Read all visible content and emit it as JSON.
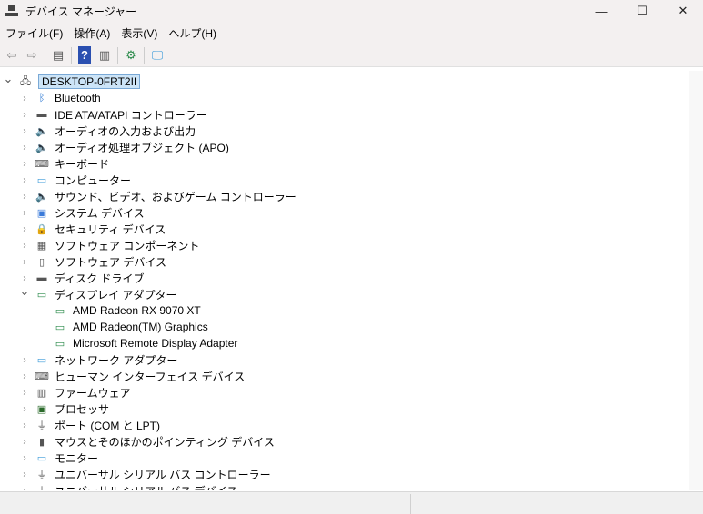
{
  "window": {
    "title": "デバイス マネージャー",
    "minimize": "—",
    "maximize": "☐",
    "close": "✕"
  },
  "menu": [
    "ファイル(F)",
    "操作(A)",
    "表示(V)",
    "ヘルプ(H)"
  ],
  "toolbar": [
    {
      "name": "back-icon",
      "glyph": "⇦"
    },
    {
      "name": "forward-icon",
      "glyph": "⇨"
    },
    {
      "name": "sep"
    },
    {
      "name": "show-hide-tree-icon",
      "glyph": "▤"
    },
    {
      "name": "sep"
    },
    {
      "name": "help-icon",
      "glyph": "?"
    },
    {
      "name": "properties-icon",
      "glyph": "▥"
    },
    {
      "name": "sep"
    },
    {
      "name": "update-driver-icon",
      "glyph": "⚙"
    },
    {
      "name": "sep"
    },
    {
      "name": "scan-hardware-icon",
      "glyph": "🖵"
    }
  ],
  "tree": [
    {
      "label": "DESKTOP-0FRT2II",
      "level": 0,
      "expanded": true,
      "icon": "computer-network-icon"
    },
    {
      "label": "Bluetooth",
      "level": 1,
      "icon": "bluetooth-icon"
    },
    {
      "label": "IDE ATA/ATAPI コントローラー",
      "level": 1,
      "icon": "ide-controller-icon"
    },
    {
      "label": "オーディオの入力および出力",
      "level": 1,
      "icon": "speaker-icon"
    },
    {
      "label": "オーディオ処理オブジェクト (APO)",
      "level": 1,
      "icon": "speaker-icon"
    },
    {
      "label": "キーボード",
      "level": 1,
      "icon": "keyboard-icon"
    },
    {
      "label": "コンピューター",
      "level": 1,
      "icon": "monitor-icon"
    },
    {
      "label": "サウンド、ビデオ、およびゲーム コントローラー",
      "level": 1,
      "icon": "speaker-icon"
    },
    {
      "label": "システム デバイス",
      "level": 1,
      "icon": "system-device-icon"
    },
    {
      "label": "セキュリティ デバイス",
      "level": 1,
      "icon": "security-device-icon"
    },
    {
      "label": "ソフトウェア コンポーネント",
      "level": 1,
      "icon": "software-component-icon"
    },
    {
      "label": "ソフトウェア デバイス",
      "level": 1,
      "icon": "software-device-icon"
    },
    {
      "label": "ディスク ドライブ",
      "level": 1,
      "icon": "disk-drive-icon"
    },
    {
      "label": "ディスプレイ アダプター",
      "level": 1,
      "expanded": true,
      "icon": "display-adapter-icon"
    },
    {
      "label": "AMD Radeon RX 9070 XT",
      "level": 2,
      "icon": "display-adapter-icon"
    },
    {
      "label": "AMD Radeon(TM) Graphics",
      "level": 2,
      "icon": "display-adapter-icon"
    },
    {
      "label": "Microsoft Remote Display Adapter",
      "level": 2,
      "icon": "display-adapter-icon"
    },
    {
      "label": "ネットワーク アダプター",
      "level": 1,
      "icon": "network-adapter-icon"
    },
    {
      "label": "ヒューマン インターフェイス デバイス",
      "level": 1,
      "icon": "hid-icon"
    },
    {
      "label": "ファームウェア",
      "level": 1,
      "icon": "firmware-icon"
    },
    {
      "label": "プロセッサ",
      "level": 1,
      "icon": "processor-icon"
    },
    {
      "label": "ポート (COM と LPT)",
      "level": 1,
      "icon": "port-icon"
    },
    {
      "label": "マウスとそのほかのポインティング デバイス",
      "level": 1,
      "icon": "mouse-icon"
    },
    {
      "label": "モニター",
      "level": 1,
      "icon": "monitor-icon"
    },
    {
      "label": "ユニバーサル シリアル バス コントローラー",
      "level": 1,
      "icon": "usb-icon"
    },
    {
      "label": "ユニバーサル シリアル バス デバイス",
      "level": 1,
      "icon": "usb-icon"
    }
  ],
  "icon_glyphs": {
    "computer-network-icon": "🖧",
    "bluetooth-icon": "ᛒ",
    "ide-controller-icon": "▬",
    "speaker-icon": "🔈",
    "keyboard-icon": "⌨",
    "monitor-icon": "▭",
    "system-device-icon": "▣",
    "security-device-icon": "🔒",
    "software-component-icon": "▦",
    "software-device-icon": "▯",
    "disk-drive-icon": "▬",
    "display-adapter-icon": "▭",
    "network-adapter-icon": "▭",
    "hid-icon": "⌨",
    "firmware-icon": "▥",
    "processor-icon": "▣",
    "port-icon": "⏚",
    "mouse-icon": "▮",
    "usb-icon": "⏚"
  },
  "icon_colors": {
    "bluetooth-icon": "#1f6fd1",
    "display-adapter-icon": "#2a8a4a",
    "monitor-icon": "#3a9ad9",
    "network-adapter-icon": "#3a9ad9",
    "processor-icon": "#2a6a2a",
    "system-device-icon": "#3a7ad9",
    "default": "#555555"
  }
}
